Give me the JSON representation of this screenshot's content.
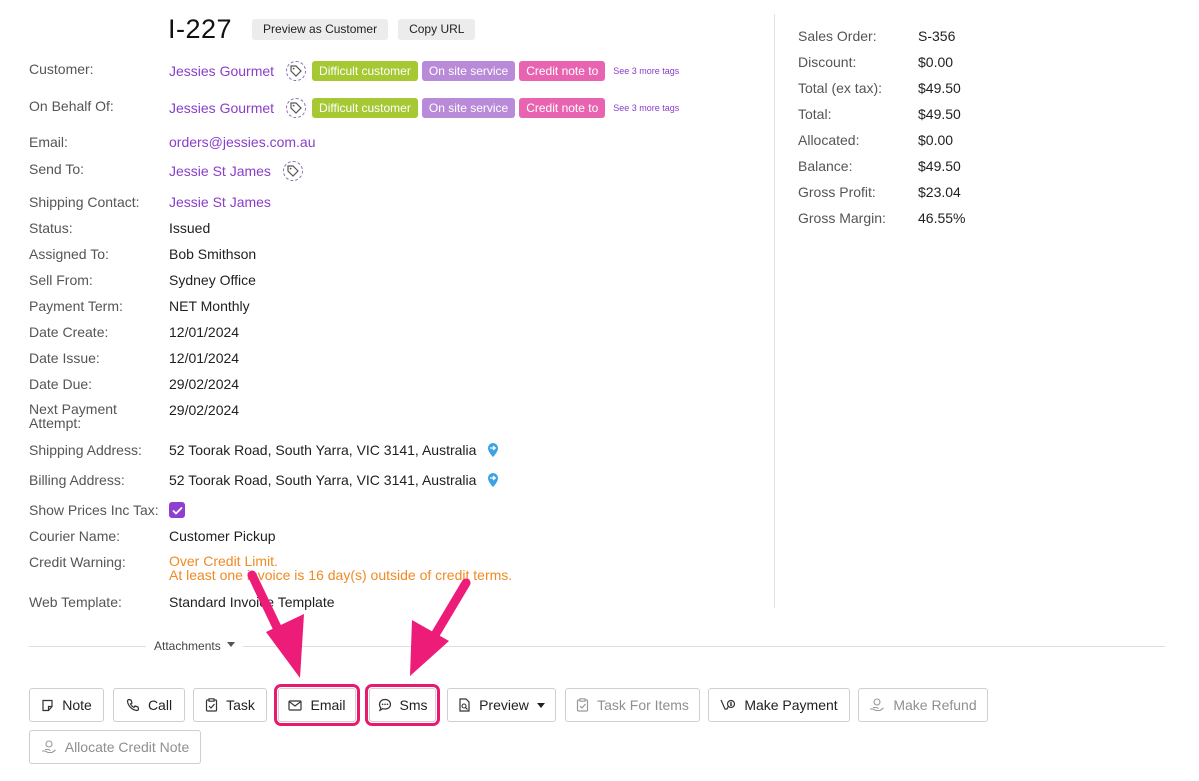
{
  "header": {
    "invoice_number": "I-227",
    "preview_btn": "Preview as Customer",
    "copy_url_btn": "Copy URL"
  },
  "fields": {
    "customer": {
      "label": "Customer:",
      "value": "Jessies Gourmet"
    },
    "on_behalf_of": {
      "label": "On Behalf Of:",
      "value": "Jessies Gourmet"
    },
    "tags": [
      "Difficult customer",
      "On site service",
      "Credit note to"
    ],
    "more_tags": "See 3 more tags",
    "email": {
      "label": "Email:",
      "value": "orders@jessies.com.au"
    },
    "send_to": {
      "label": "Send To:",
      "value": "Jessie St James"
    },
    "shipping_contact": {
      "label": "Shipping Contact:",
      "value": "Jessie St James"
    },
    "status": {
      "label": "Status:",
      "value": "Issued"
    },
    "assigned_to": {
      "label": "Assigned To:",
      "value": "Bob Smithson"
    },
    "sell_from": {
      "label": "Sell From:",
      "value": "Sydney Office"
    },
    "payment_term": {
      "label": "Payment Term:",
      "value": "NET Monthly"
    },
    "date_create": {
      "label": "Date Create:",
      "value": "12/01/2024"
    },
    "date_issue": {
      "label": "Date Issue:",
      "value": "12/01/2024"
    },
    "date_due": {
      "label": "Date Due:",
      "value": "29/02/2024"
    },
    "next_payment": {
      "label_line1": "Next Payment",
      "label_line2": "Attempt:",
      "value": "29/02/2024"
    },
    "shipping_address": {
      "label": "Shipping Address:",
      "value": "52 Toorak Road, South Yarra, VIC 3141, Australia"
    },
    "billing_address": {
      "label": "Billing Address:",
      "value": "52 Toorak Road, South Yarra, VIC 3141, Australia"
    },
    "show_prices": {
      "label": "Show Prices Inc Tax:",
      "checked": true
    },
    "courier_name": {
      "label": "Courier Name:",
      "value": "Customer Pickup"
    },
    "credit_warning": {
      "label": "Credit Warning:",
      "line1": "Over Credit Limit.",
      "line2": "At least one invoice is 16 day(s) outside of credit terms."
    },
    "web_template": {
      "label": "Web Template:",
      "value": "Standard Invoice Template"
    }
  },
  "summary": {
    "sales_order": {
      "label": "Sales Order:",
      "value": "S-356"
    },
    "discount": {
      "label": "Discount:",
      "value": "$0.00"
    },
    "total_ex_tax": {
      "label": "Total (ex tax):",
      "value": "$49.50"
    },
    "total": {
      "label": "Total:",
      "value": "$49.50"
    },
    "allocated": {
      "label": "Allocated:",
      "value": "$0.00"
    },
    "balance": {
      "label": "Balance:",
      "value": "$49.50"
    },
    "gross_profit": {
      "label": "Gross Profit:",
      "value": "$23.04"
    },
    "gross_margin": {
      "label": "Gross Margin:",
      "value": "46.55%"
    }
  },
  "attachments": {
    "label": "Attachments"
  },
  "actions": {
    "note": "Note",
    "call": "Call",
    "task": "Task",
    "email": "Email",
    "sms": "Sms",
    "preview": "Preview",
    "task_for_items": "Task For Items",
    "make_payment": "Make Payment",
    "make_refund": "Make Refund",
    "allocate_credit_note": "Allocate Credit Note"
  },
  "colors": {
    "link": "#8a3ec9",
    "warning": "#f08a24",
    "tag_green": "#a6c832",
    "tag_purple": "#b88ad8",
    "tag_pink": "#e964b0",
    "highlight": "#e8196f"
  }
}
